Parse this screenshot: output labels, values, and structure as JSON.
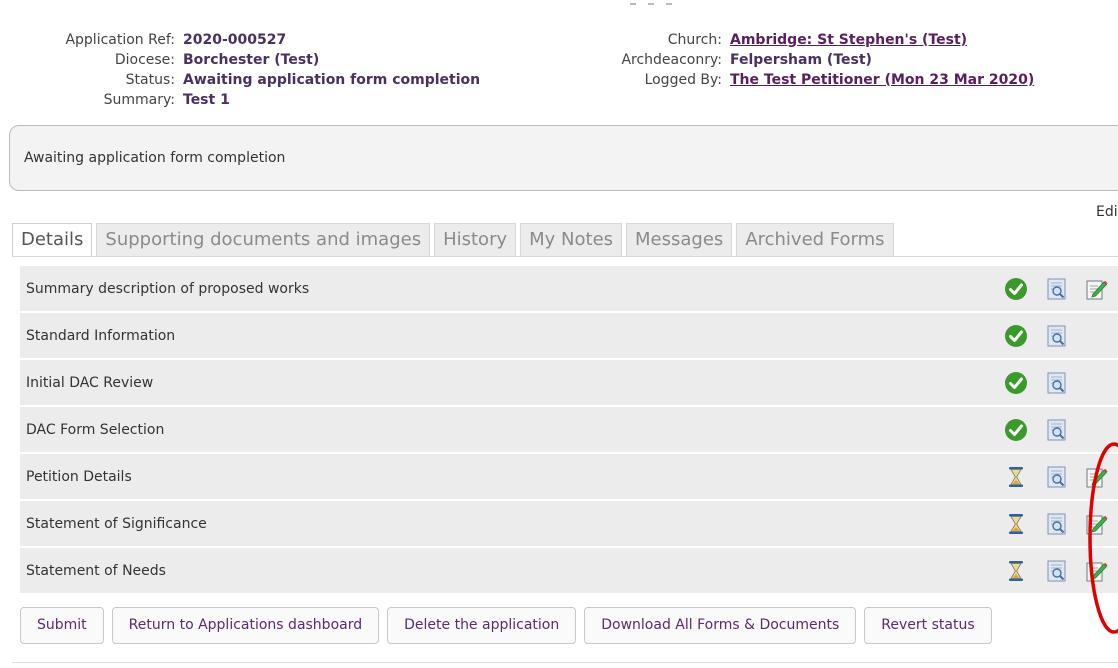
{
  "header": {
    "left": [
      {
        "label": "Application Ref:",
        "value": "2020-000527"
      },
      {
        "label": "Diocese:",
        "value": "Borchester (Test)"
      },
      {
        "label": "Status:",
        "value": "Awaiting application form completion"
      },
      {
        "label": "Summary:",
        "value": "Test 1"
      }
    ],
    "right": [
      {
        "label": "Church:",
        "value": "Ambridge: St Stephen's (Test)"
      },
      {
        "label": "Archdeaconry:",
        "value": "Felpersham (Test)"
      },
      {
        "label": "Logged By:",
        "value": "The Test Petitioner (Mon 23 Mar 2020)"
      }
    ]
  },
  "status_box": {
    "text": "Awaiting application form completion"
  },
  "edit_link": "Edi",
  "tabs": [
    {
      "label": "Details"
    },
    {
      "label": "Supporting documents and images"
    },
    {
      "label": "History"
    },
    {
      "label": "My Notes"
    },
    {
      "label": "Messages"
    },
    {
      "label": "Archived Forms"
    }
  ],
  "forms": [
    {
      "name": "Summary description of proposed works",
      "status": "complete",
      "editable": true
    },
    {
      "name": "Standard Information",
      "status": "complete",
      "editable": false
    },
    {
      "name": "Initial DAC Review",
      "status": "complete",
      "editable": false
    },
    {
      "name": "DAC Form Selection",
      "status": "complete",
      "editable": false
    },
    {
      "name": "Petition Details",
      "status": "pending",
      "editable": true
    },
    {
      "name": "Statement of Significance",
      "status": "pending",
      "editable": true
    },
    {
      "name": "Statement of Needs",
      "status": "pending",
      "editable": true
    }
  ],
  "icons": {
    "complete": "green-check-icon",
    "pending": "hourglass-icon",
    "view": "view-document-icon",
    "edit": "edit-document-icon"
  },
  "buttons": {
    "submit": "Submit",
    "return": "Return to Applications dashboard",
    "delete": "Delete the application",
    "download": "Download All Forms & Documents",
    "revert": "Revert status"
  },
  "colors": {
    "link": "#5a1f5f",
    "row_bg": "#ececec",
    "check": "#3a9a2b",
    "annotation": "#e00000"
  }
}
